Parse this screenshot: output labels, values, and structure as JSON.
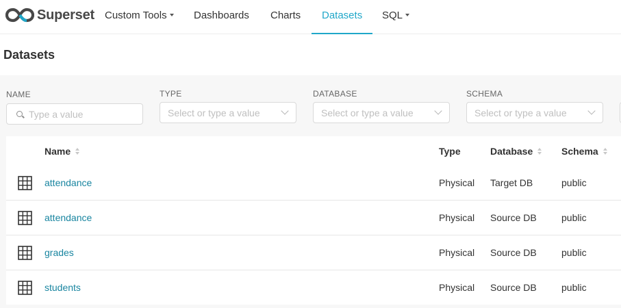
{
  "navbar": {
    "brand": "Superset",
    "items": [
      {
        "label": "Custom Tools",
        "has_caret": true,
        "active": false
      },
      {
        "label": "Dashboards",
        "has_caret": false,
        "active": false
      },
      {
        "label": "Charts",
        "has_caret": false,
        "active": false
      },
      {
        "label": "Datasets",
        "has_caret": false,
        "active": true
      },
      {
        "label": "SQL",
        "has_caret": true,
        "active": false
      }
    ]
  },
  "page": {
    "title": "Datasets"
  },
  "filters": {
    "name": {
      "label": "NAME",
      "placeholder": "Type a value"
    },
    "type": {
      "label": "TYPE",
      "placeholder": "Select or type a value"
    },
    "database": {
      "label": "DATABASE",
      "placeholder": "Select or type a value"
    },
    "schema": {
      "label": "SCHEMA",
      "placeholder": "Select or type a value"
    }
  },
  "table": {
    "columns": {
      "name": "Name",
      "type": "Type",
      "database": "Database",
      "schema": "Schema"
    },
    "rows": [
      {
        "name": "attendance",
        "type": "Physical",
        "database": "Target DB",
        "schema": "public"
      },
      {
        "name": "attendance",
        "type": "Physical",
        "database": "Source DB",
        "schema": "public"
      },
      {
        "name": "grades",
        "type": "Physical",
        "database": "Source DB",
        "schema": "public"
      },
      {
        "name": "students",
        "type": "Physical",
        "database": "Source DB",
        "schema": "public"
      }
    ]
  },
  "colors": {
    "accent": "#20a7c9",
    "link": "#1985a0",
    "text": "#323232",
    "panel_bg": "#f7f7f7"
  },
  "icons": {
    "brand": "superset-logo-icon",
    "row": "table-grid-icon",
    "search": "search-icon",
    "dropdown": "chevron-down-icon",
    "sort": "sort-icon"
  }
}
